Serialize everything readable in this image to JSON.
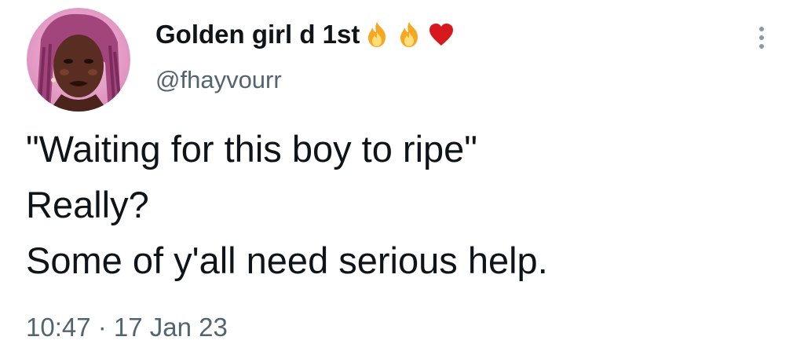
{
  "author": {
    "display_name": "Golden girl d 1st",
    "name_emojis": [
      "fire-emoji",
      "fire-emoji",
      "red-heart-emoji"
    ],
    "handle": "@fhayvourr"
  },
  "tweet": {
    "lines": [
      "\"Waiting for this boy to ripe\"",
      "Really?",
      "Some of y'all need serious help."
    ]
  },
  "meta": {
    "time": "10:47",
    "separator": " · ",
    "date": "17 Jan 23"
  },
  "icons": {
    "more": "more-vertical-icon"
  },
  "colors": {
    "text_primary": "#0f1419",
    "text_secondary": "#536471",
    "background": "#ffffff",
    "heart": "#d7191e",
    "fire": "#f7a823"
  }
}
